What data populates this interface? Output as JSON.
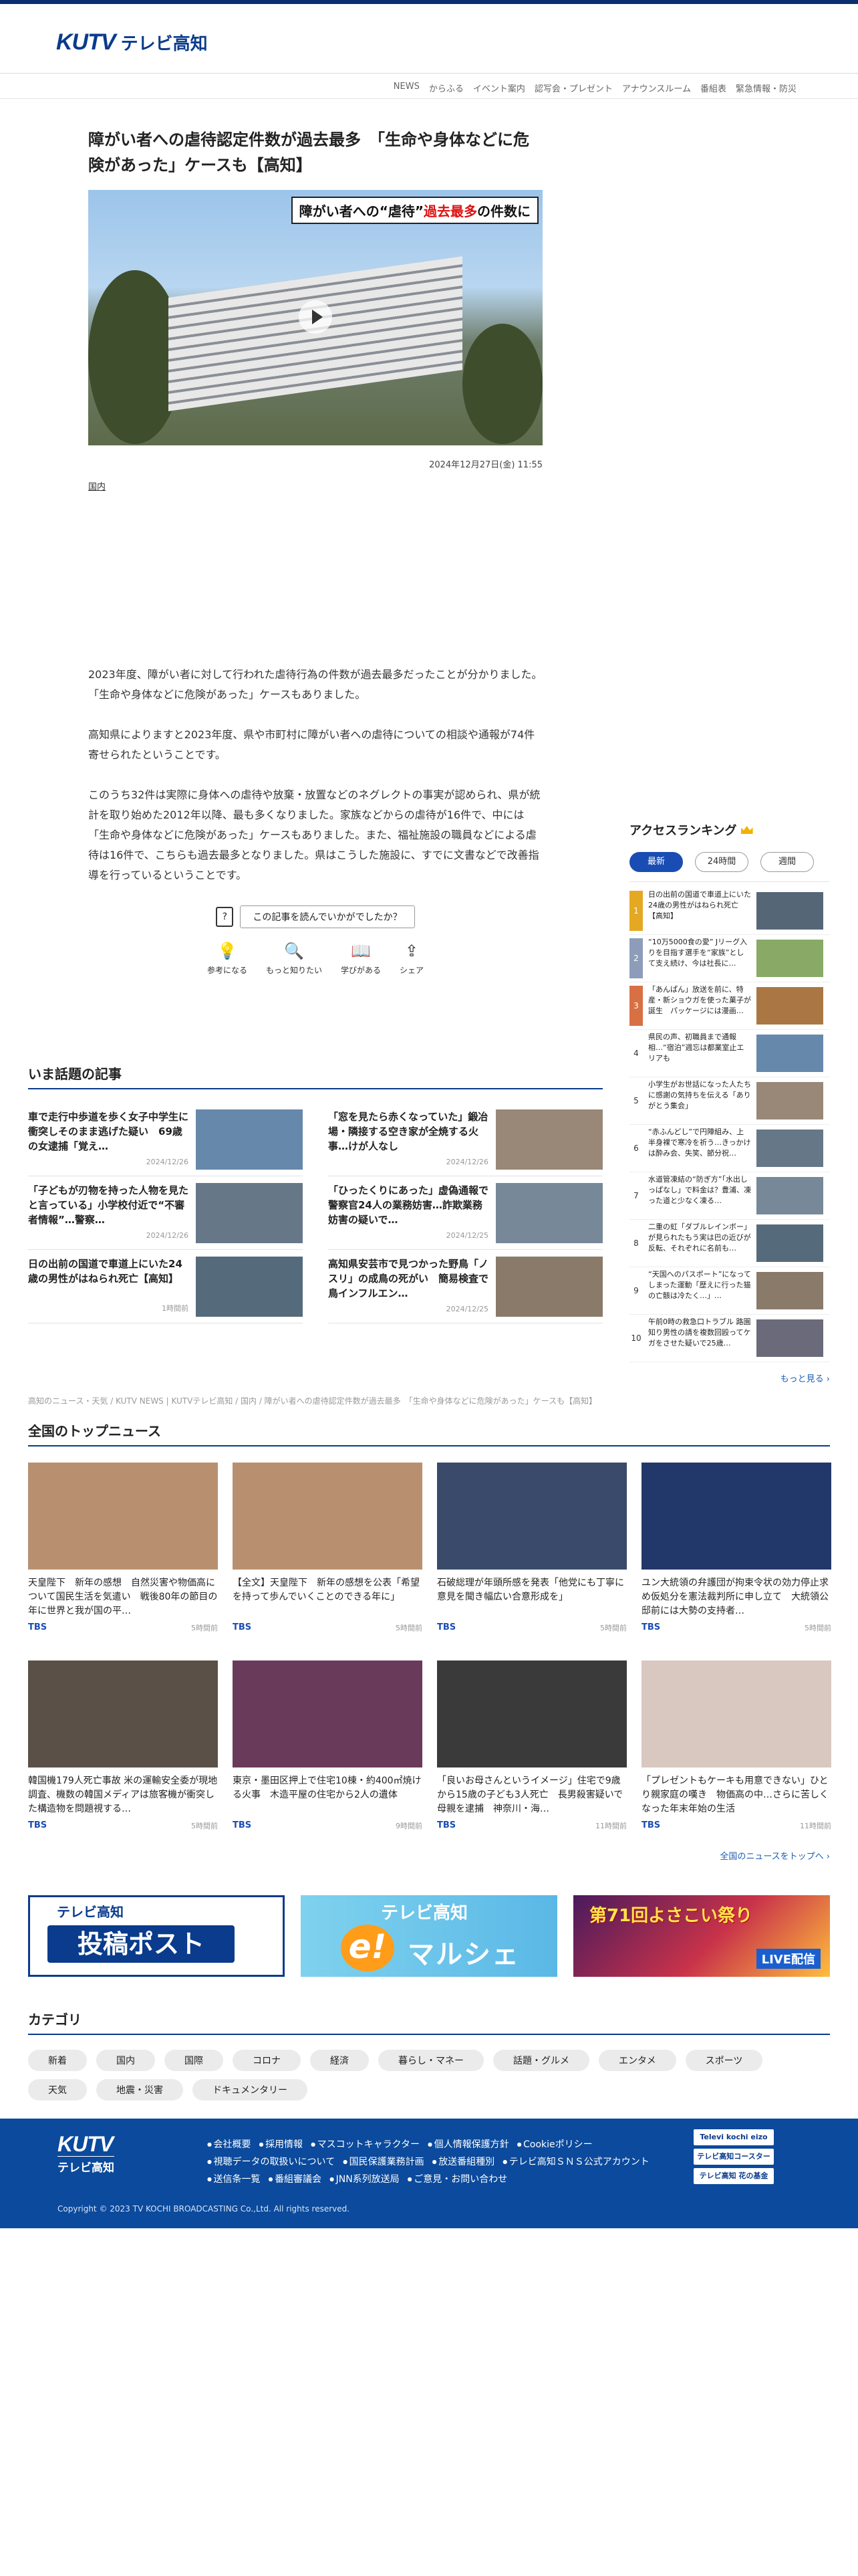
{
  "header": {
    "logo_mark": "KUTV",
    "logo_jp": "テレビ高知"
  },
  "nav": [
    "NEWS",
    "からふる",
    "イベント案内",
    "認写会・プレゼント",
    "アナウンスルーム",
    "番組表",
    "緊急情報・防災"
  ],
  "article": {
    "title": "障がい者への虐待認定件数が過去最多　「生命や身体などに危険があった」ケースも【高知】",
    "hero_caption_prefix": "障がい者への“虐待”",
    "hero_caption_highlight": "過去最多",
    "hero_caption_suffix": "の件数に",
    "date": "2024年12月27日(金) 11:55",
    "category": "国内",
    "paragraphs": [
      "2023年度、障がい者に対して行われた虐待行為の件数が過去最多だったことが分かりました。「生命や身体などに危険があった」ケースもありました。",
      "高知県によりますと2023年度、県や市町村に障がい者への虐待についての相談や通報が74件寄せられたということです。",
      "このうち32件は実際に身体への虐待や放棄・放置などのネグレクトの事実が認められ、県が統計を取り始めた2012年以降、最も多くなりました。家族などからの虐待が16件で、中には「生命や身体などに危険があった」ケースもありました。また、福祉施設の職員などによる虐待は16件で、こちらも過去最多となりました。県はこうした施設に、すでに文書などで改善指導を行っているということです。"
    ],
    "feedback_question": "この記事を読んでいかがでしたか？",
    "feedback_icon": "?",
    "reactions": [
      {
        "label": "参考になる",
        "icon": "lightbulb-icon",
        "glyph": "💡"
      },
      {
        "label": "もっと知りたい",
        "icon": "magnifier-icon",
        "glyph": "🔍"
      },
      {
        "label": "学びがある",
        "icon": "book-icon",
        "glyph": "📖"
      },
      {
        "label": "シェア",
        "icon": "share-icon",
        "glyph": "⇪"
      }
    ]
  },
  "topics": {
    "heading": "いま話題の記事",
    "items": [
      {
        "title": "車で走行中歩道を歩く女子中学生に衝突しそのまま逃げた疑い　69歳の女逮捕「覚え…",
        "date": "2024/12/26"
      },
      {
        "title": "「窓を見たら赤くなっていた」鍛冶場・隣接する空き家が全焼する火事…けが人なし",
        "date": "2024/12/26"
      },
      {
        "title": "「子どもが刃物を持った人物を見たと言っている」小学校付近で“不審者情報”…警察…",
        "date": "2024/12/26"
      },
      {
        "title": "「ひったくりにあった」虚偽通報で警察官24人の業務妨害…詐欺業務妨害の疑いで…",
        "date": "2024/12/25"
      },
      {
        "title": "日の出前の国道で車道上にいた24歳の男性がはねられ死亡【高知】",
        "date": "1時間前"
      },
      {
        "title": "高知県安芸市で見つかった野鳥「ノスリ」の成鳥の死がい　簡易検査で鳥インフルエン…",
        "date": "2024/12/25"
      }
    ]
  },
  "breadcrumb": "高知のニュース・天気 / KUTV NEWS | KUTVテレビ高知 / 国内 / 障がい者への虐待認定件数が過去最多　「生命や身体などに危険があった」ケースも【高知】",
  "ranking": {
    "heading": "アクセスランキング",
    "tabs": [
      "最新",
      "24時間",
      "週間"
    ],
    "active_tab": "最新",
    "items": [
      {
        "num": "1",
        "text": "日の出前の国道で車道上にいた24歳の男性がはねられ死亡【高知】"
      },
      {
        "num": "2",
        "text": "“10万5000食の愛” Jリーグ入りを目指す選手を“家族”として支え続け、今は社長に…"
      },
      {
        "num": "3",
        "text": "「あんぱん」放送を前に、特産・新ショウガを使った菓子が誕生　パッケージには漫画…"
      },
      {
        "num": "4",
        "text": "県民の声、初職員まで通報相…“宿泊”週忘は都業室止エリアも"
      },
      {
        "num": "5",
        "text": "小学生がお世話になった人たちに感謝の気持ちを伝える「ありがとう集会」"
      },
      {
        "num": "6",
        "text": "“赤ふんどし”で円陣組み、上半身裸で寒冷を祈う…きっかけは酔み会、失笑、節分祝…"
      },
      {
        "num": "7",
        "text": "水道管凍結の“防ぎ方”「水出しっぱなし」で料金は？豊浦、凍った道と少なく凍る…"
      },
      {
        "num": "8",
        "text": "二重の虹「ダブルレインボー」が見られたもう実は巴の近びが反転、それぞれに名前も…"
      },
      {
        "num": "9",
        "text": "“天国へのパスポート”になってしまった運動「歴えに行った猫の亡骸は冷たく…」…"
      },
      {
        "num": "10",
        "text": "午前0時の救急口トラブル 路園知り男性の請を複数回殴ってケガをさせた疑いで25歳…"
      }
    ],
    "more": "もっと見る ›"
  },
  "national": {
    "heading": "全国のトップニュース",
    "items": [
      {
        "title": "天皇陛下　新年の感想　自然災害や物価高について国民生活を気遣い　戦後80年の節目の年に世界と我が国の平…",
        "source": "TBS",
        "time": "5時間前"
      },
      {
        "title": "【全文】天皇陛下　新年の感想を公表「希望を持って歩んでいくことのできる年に」",
        "source": "TBS",
        "time": "5時間前"
      },
      {
        "title": "石破総理が年頭所感を発表「他党にも丁寧に意見を聞き幅広い合意形成を」",
        "source": "TBS",
        "time": "5時間前"
      },
      {
        "title": "ユン大統領の弁護団が拘束令状の効力停止求め仮処分を憲法裁判所に申し立て　大統領公邸前には大勢の支持者…",
        "source": "TBS",
        "time": "5時間前"
      },
      {
        "title": "韓国機179人死亡事故 米の運輸安全委が現地調査、機数の韓国メディアは旅客機が衝突した構造物を問題視する…",
        "source": "TBS",
        "time": "5時間前"
      },
      {
        "title": "東京・墨田区押上で住宅10棟・約400㎡焼ける火事　木造平屋の住宅から2人の遺体",
        "source": "TBS",
        "time": "9時間前"
      },
      {
        "title": "「良いお母さんというイメージ」住宅で9歳から15歳の子ども3人死亡　長男殺害疑いで母親を逮捕　神奈川・海…",
        "source": "TBS",
        "time": "11時間前"
      },
      {
        "title": "「プレゼントもケーキも用意できない」ひとり親家庭の嘆き　物価高の中…さらに苦しくなった年末年始の生活",
        "source": "TBS",
        "time": "11時間前"
      }
    ],
    "more": "全国のニュースをトップへ ›"
  },
  "banners": {
    "post_top": "テレビ高知",
    "post_main": "投稿ポスト",
    "marche_top": "テレビ高知",
    "marche_e": "e!",
    "marche_main": "マルシェ",
    "festival_title": "第71回よさこい祭り",
    "festival_live": "LIVE配信"
  },
  "categories": {
    "heading": "カテゴリ",
    "items": [
      "新着",
      "国内",
      "国際",
      "コロナ",
      "経済",
      "暮らし・マネー",
      "話題・グルメ",
      "エンタメ",
      "スポーツ",
      "天気",
      "地震・災害",
      "ドキュメンタリー"
    ]
  },
  "footer": {
    "logo_mark": "KUTV",
    "logo_jp": "テレビ高知",
    "links": [
      "会社概要",
      "採用情報",
      "マスコットキャラクター",
      "個人情報保護方針",
      "Cookieポリシー",
      "視聴データの取扱いについて",
      "国民保護業務計画",
      "放送番組種別",
      "テレビ高知ＳＮＳ公式アカウント",
      "送信条一覧",
      "番組審議会",
      "JNN系列放送局",
      "ご意見・お問い合わせ"
    ],
    "sponsors": [
      "Televi kochi eizo",
      "テレビ高知コースター",
      "テレビ高知 花の基金"
    ],
    "copyright": "Copyright © 2023 TV KOCHI BROADCASTING Co.,Ltd. All rights reserved."
  },
  "colors": {
    "brand": "#0a3b8c",
    "accent_blue": "#1a4db3",
    "footer_bg": "#0b4a9c",
    "rank1": "#e5a823",
    "rank2": "#8d9db9",
    "rank3": "#d87044"
  }
}
